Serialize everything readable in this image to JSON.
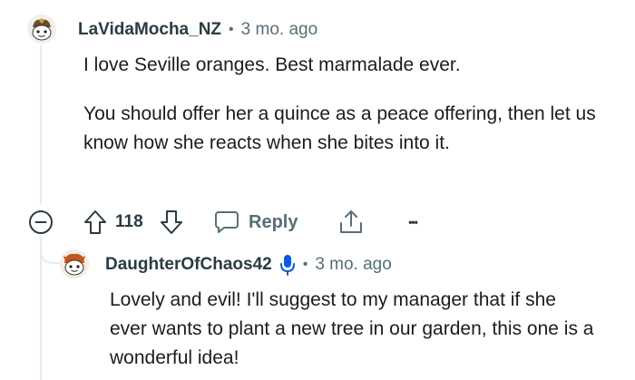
{
  "comment": {
    "username": "LaVidaMocha_NZ",
    "separator": "•",
    "time": "3 mo. ago",
    "paragraphs": [
      "I love Seville oranges. Best marmalade ever.",
      "You should offer her a quince as a peace offering, then let us know how she reacts when she bites into it."
    ],
    "vote_count": "118",
    "reply_label": "Reply",
    "more_label": "•••"
  },
  "reply": {
    "username": "DaughterOfChaos42",
    "separator": "•",
    "time": "3 mo. ago",
    "body": "Lovely and evil! I'll suggest to my manager that if she ever wants to plant a new tree in our garden, this one is a wonderful idea!"
  },
  "colors": {
    "accent_blue": "#0a5bd6",
    "meta_gray": "#576f76",
    "thread_line": "#e5ebee"
  }
}
